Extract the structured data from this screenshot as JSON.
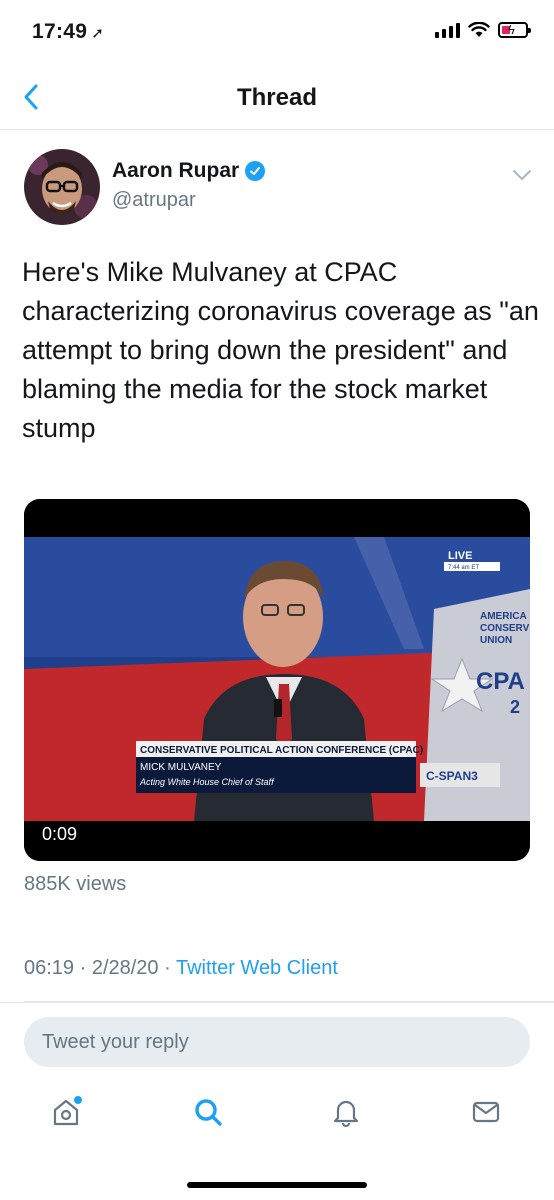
{
  "status_bar": {
    "time": "17:49"
  },
  "nav": {
    "title": "Thread"
  },
  "tweet": {
    "author_name": "Aaron Rupar",
    "handle": "@atrupar",
    "text": "Here's Mike Mulvaney at CPAC characterizing coronavirus coverage as \"an attempt to bring down the president\" and blaming the media for the stock market stump",
    "video": {
      "duration": "0:09",
      "live_label": "LIVE",
      "live_time": "7:44 am ET",
      "lower_third_title": "CONSERVATIVE POLITICAL ACTION CONFERENCE (CPAC)",
      "lower_third_name": "MICK MULVANEY",
      "lower_third_role": "Acting White House Chief of Staff",
      "network": "C-SPAN3",
      "banner_lines": [
        "AMERICA",
        "CONSERV",
        "UNION"
      ],
      "banner_logo": "CPA",
      "banner_num": "2"
    },
    "views": "885K views",
    "timestamp": "06:19 · 2/28/20 · ",
    "client": "Twitter Web Client"
  },
  "reply": {
    "placeholder": "Tweet your reply"
  },
  "tabbar": {
    "items": [
      {
        "name": "home",
        "icon": "home-icon"
      },
      {
        "name": "search",
        "icon": "search-icon"
      },
      {
        "name": "notifications",
        "icon": "bell-icon"
      },
      {
        "name": "messages",
        "icon": "mail-icon"
      }
    ]
  },
  "colors": {
    "accent": "#1da1f2",
    "muted": "#657786",
    "text": "#14171a"
  }
}
